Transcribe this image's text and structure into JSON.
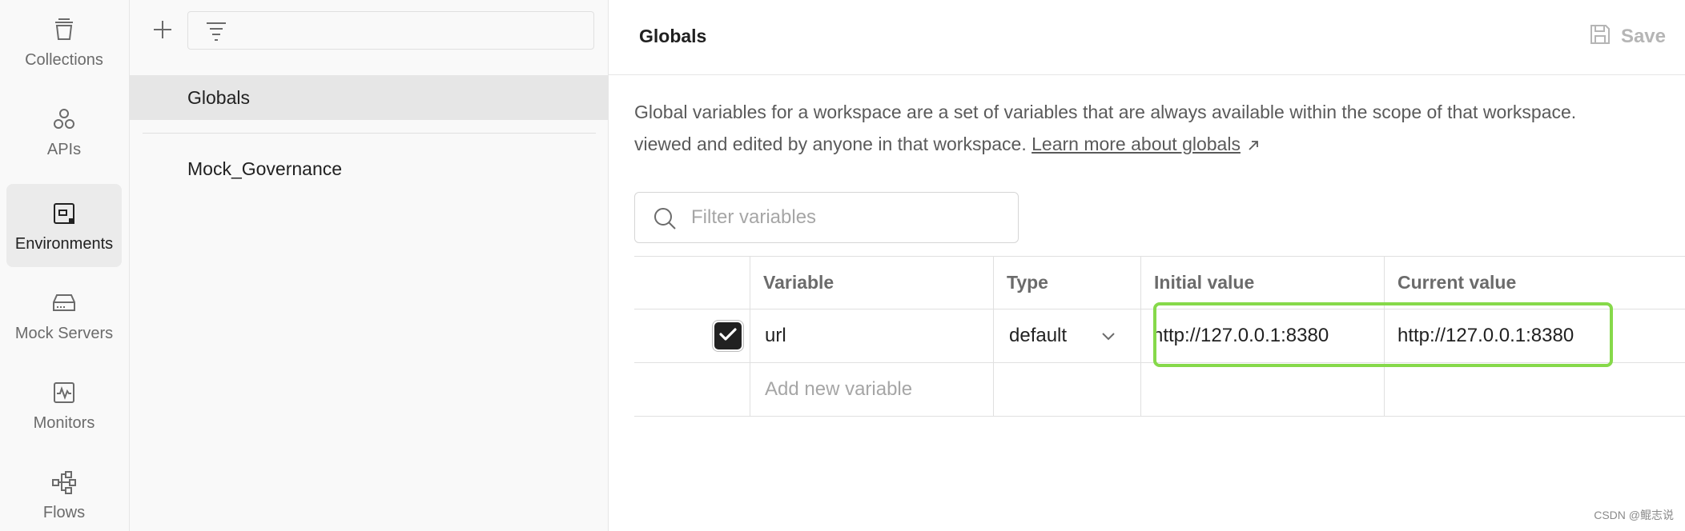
{
  "sidebar": {
    "items": [
      {
        "label": "Collections",
        "icon": "collections-icon",
        "active": false
      },
      {
        "label": "APIs",
        "icon": "apis-icon",
        "active": false
      },
      {
        "label": "Environments",
        "icon": "environments-icon",
        "active": true
      },
      {
        "label": "Mock Servers",
        "icon": "mock-servers-icon",
        "active": false
      },
      {
        "label": "Monitors",
        "icon": "monitors-icon",
        "active": false
      },
      {
        "label": "Flows",
        "icon": "flows-icon",
        "active": false
      }
    ]
  },
  "env_list": {
    "items": [
      {
        "label": "Globals",
        "selected": true
      },
      {
        "label": "Mock_Governance",
        "selected": false
      }
    ]
  },
  "main": {
    "title": "Globals",
    "save_label": "Save",
    "description_line1": "Global variables for a workspace are a set of variables that are always available within the scope of that workspace.",
    "description_line2": "viewed and edited by anyone in that workspace.",
    "learn_more": "Learn more about globals",
    "filter_placeholder": "Filter variables"
  },
  "table": {
    "headers": {
      "variable": "Variable",
      "type": "Type",
      "initial": "Initial value",
      "current": "Current value"
    },
    "rows": [
      {
        "enabled": true,
        "variable": "url",
        "type": "default",
        "initial": "http://127.0.0.1:8380",
        "current": "http://127.0.0.1:8380"
      }
    ],
    "add_placeholder": "Add new variable"
  },
  "colors": {
    "highlight": "#86d94a",
    "active_bg": "#ebebeb",
    "selected_row_bg": "#e6e6e6"
  },
  "watermark": "CSDN @鲲志说"
}
